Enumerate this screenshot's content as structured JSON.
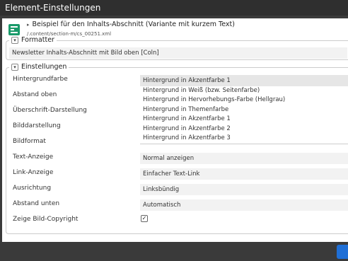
{
  "window": {
    "title": "Element-Einstellungen"
  },
  "resource": {
    "title": "Beispiel für den Inhalts-Abschnitt (Variante mit kurzem Text)",
    "path": "/.content/section-m/cs_00251.xml"
  },
  "formatter": {
    "legend": "Formatter",
    "value": "Newsletter Inhalts-Abschnitt mit Bild oben [Coln]"
  },
  "settings": {
    "legend": "Einstellungen",
    "rows": [
      {
        "label": "Hintergrundfarbe",
        "value": "Hintergrund in Akzentfarbe 1"
      },
      {
        "label": "Abstand oben",
        "value": ""
      },
      {
        "label": "Überschrift-Darstellung",
        "value": ""
      },
      {
        "label": "Bilddarstellung",
        "value": ""
      },
      {
        "label": "Bildformat",
        "value": ""
      },
      {
        "label": "Text-Anzeige",
        "value": "Normal anzeigen"
      },
      {
        "label": "Link-Anzeige",
        "value": "Einfacher Text-Link"
      },
      {
        "label": "Ausrichtung",
        "value": "Linksbündig"
      },
      {
        "label": "Abstand unten",
        "value": "Automatisch"
      },
      {
        "label": "Zeige Bild-Copyright",
        "checked": true
      }
    ],
    "dropdown_options": [
      "Hintergrund in Weiß (bzw. Seitenfarbe)",
      "Hintergrund in Hervorhebungs-Farbe (Hellgrau)",
      "Hintergrund in Themenfarbe",
      "Hintergrund in Akzentfarbe 1",
      "Hintergrund in Akzentfarbe 2",
      "Hintergrund in Akzentfarbe 3"
    ]
  },
  "colors": {
    "accent": "#1f6fd6",
    "resource_icon": "#1a9a6a",
    "titlebar": "#2f2f2f"
  },
  "icons": {
    "resource": "resource-type-icon",
    "triangle": "expand-triangle-icon",
    "toggle": "collapse-toggle-icon",
    "check": "checkmark-icon"
  }
}
